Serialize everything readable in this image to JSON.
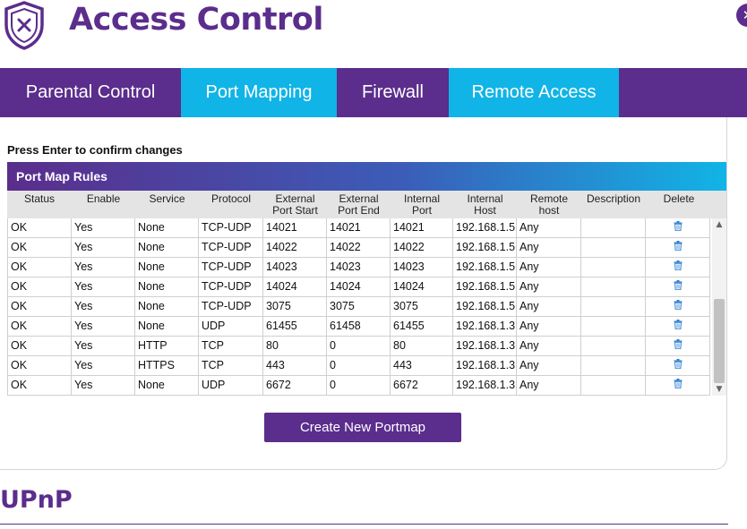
{
  "header": {
    "title": "Access Control",
    "icon": "shield-x-icon",
    "close_label": "✕"
  },
  "tabs": [
    {
      "label": "Parental Control",
      "active": false
    },
    {
      "label": "Port Mapping",
      "active": true
    },
    {
      "label": "Firewall",
      "active": false
    },
    {
      "label": "Remote Access",
      "active": false
    }
  ],
  "hint": "Press Enter to confirm changes",
  "rules": {
    "title": "Port Map Rules",
    "columns": [
      "Status",
      "Enable",
      "Service",
      "Protocol",
      "External Port Start",
      "External Port End",
      "Internal Port",
      "Internal Host",
      "Remote host",
      "Description",
      "Delete"
    ],
    "column_lines": [
      [
        "Status"
      ],
      [
        "Enable"
      ],
      [
        "Service"
      ],
      [
        "Protocol"
      ],
      [
        "External",
        "Port Start"
      ],
      [
        "External",
        "Port End"
      ],
      [
        "Internal",
        "Port"
      ],
      [
        "Internal",
        "Host"
      ],
      [
        "Remote",
        "host"
      ],
      [
        "Description"
      ],
      [
        "Delete"
      ]
    ],
    "rows": [
      [
        "OK",
        "Yes",
        "None",
        "TCP-UDP",
        "14021",
        "14021",
        "14021",
        "192.168.1.5",
        "Any",
        "",
        "trash-icon"
      ],
      [
        "OK",
        "Yes",
        "None",
        "TCP-UDP",
        "14022",
        "14022",
        "14022",
        "192.168.1.5",
        "Any",
        "",
        "trash-icon"
      ],
      [
        "OK",
        "Yes",
        "None",
        "TCP-UDP",
        "14023",
        "14023",
        "14023",
        "192.168.1.5",
        "Any",
        "",
        "trash-icon"
      ],
      [
        "OK",
        "Yes",
        "None",
        "TCP-UDP",
        "14024",
        "14024",
        "14024",
        "192.168.1.5",
        "Any",
        "",
        "trash-icon"
      ],
      [
        "OK",
        "Yes",
        "None",
        "TCP-UDP",
        "3075",
        "3075",
        "3075",
        "192.168.1.5",
        "Any",
        "",
        "trash-icon"
      ],
      [
        "OK",
        "Yes",
        "None",
        "UDP",
        "61455",
        "61458",
        "61455",
        "192.168.1.3",
        "Any",
        "",
        "trash-icon"
      ],
      [
        "OK",
        "Yes",
        "HTTP",
        "TCP",
        "80",
        "0",
        "80",
        "192.168.1.3",
        "Any",
        "",
        "trash-icon"
      ],
      [
        "OK",
        "Yes",
        "HTTPS",
        "TCP",
        "443",
        "0",
        "443",
        "192.168.1.3",
        "Any",
        "",
        "trash-icon"
      ],
      [
        "OK",
        "Yes",
        "None",
        "UDP",
        "6672",
        "0",
        "6672",
        "192.168.1.3",
        "Any",
        "",
        "trash-icon"
      ]
    ]
  },
  "create_button": "Create New Portmap",
  "upnp_title": "UPnP",
  "colors": {
    "brand_purple": "#5b2d8c",
    "accent_blue": "#11b4e6",
    "delete_blue": "#2e7fd6"
  }
}
